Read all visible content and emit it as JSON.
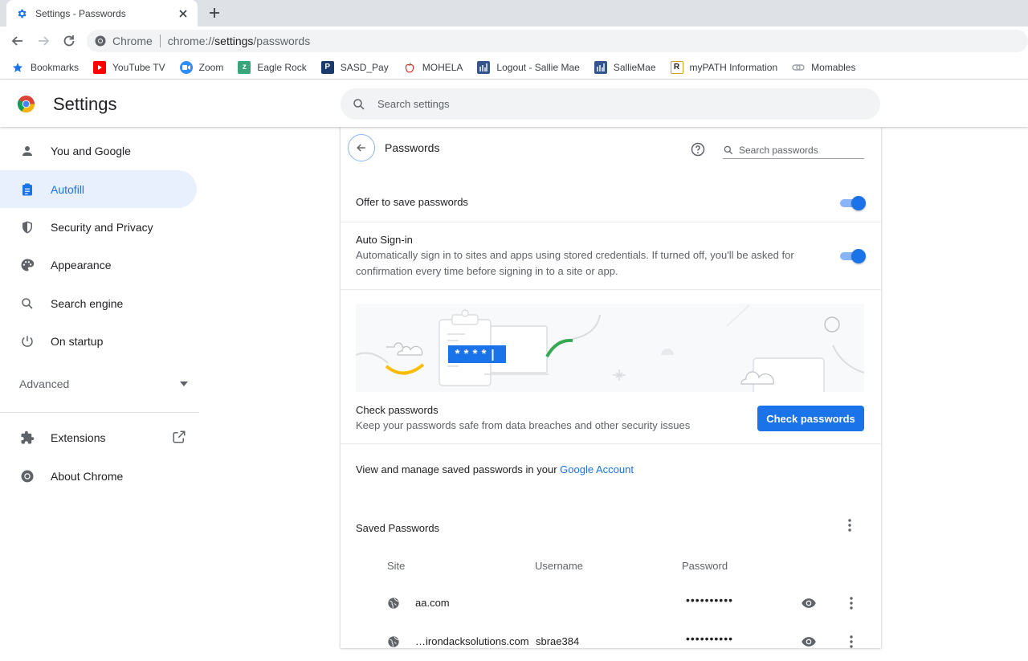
{
  "tab": {
    "title": "Settings - Passwords"
  },
  "omnibox": {
    "host": "Chrome",
    "url_prefix": "chrome://",
    "url_bold": "settings",
    "url_suffix": "/passwords"
  },
  "bookmarks": [
    {
      "label": "Bookmarks",
      "icon": "star-icon",
      "color": "#1a73e8"
    },
    {
      "label": "YouTube TV",
      "icon": "youtube-icon",
      "color": "#ff0000"
    },
    {
      "label": "Zoom",
      "icon": "zoom-icon",
      "color": "#2d8cff"
    },
    {
      "label": "Eagle Rock",
      "icon": "z-icon",
      "color": "#3aa57a"
    },
    {
      "label": "SASD_Pay",
      "icon": "p-icon",
      "color": "#1b3b6f"
    },
    {
      "label": "MOHELA",
      "icon": "apple-icon",
      "color": "#d93025"
    },
    {
      "label": "Logout - Sallie Mae",
      "icon": "salliemae-icon",
      "color": "#34558b"
    },
    {
      "label": "SallieMae",
      "icon": "salliemae-icon",
      "color": "#34558b"
    },
    {
      "label": "myPATH Information",
      "icon": "r-icon",
      "color": "#c9a227"
    },
    {
      "label": "Momables",
      "icon": "link-icon",
      "color": "#9aa0a6"
    }
  ],
  "header": {
    "title": "Settings",
    "search_placeholder": "Search settings"
  },
  "sidebar": {
    "items": [
      {
        "label": "You and Google",
        "icon": "person-icon"
      },
      {
        "label": "Autofill",
        "icon": "clipboard-icon"
      },
      {
        "label": "Security and Privacy",
        "icon": "shield-icon"
      },
      {
        "label": "Appearance",
        "icon": "palette-icon"
      },
      {
        "label": "Search engine",
        "icon": "search-icon"
      },
      {
        "label": "On startup",
        "icon": "power-icon"
      }
    ],
    "advanced": "Advanced",
    "extensions": "Extensions",
    "about": "About Chrome"
  },
  "passwords": {
    "title": "Passwords",
    "search_placeholder": "Search passwords",
    "offer_save": "Offer to save passwords",
    "auto_signin": "Auto Sign-in",
    "auto_signin_desc": "Automatically sign in to sites and apps using stored credentials. If turned off, you'll be asked for confirmation every time before signing in to a site or app.",
    "banner_text": "****|",
    "check_title": "Check passwords",
    "check_desc": "Keep your passwords safe from data breaches and other security issues",
    "check_button": "Check passwords",
    "manage_prefix": "View and manage saved passwords in your ",
    "manage_link": "Google Account",
    "saved_title": "Saved Passwords",
    "columns": {
      "site": "Site",
      "username": "Username",
      "password": "Password"
    },
    "rows": [
      {
        "site": "aa.com",
        "username": "",
        "password": "••••••••••"
      },
      {
        "site": "…irondacksolutions.com",
        "username": "sbrae384",
        "password": "••••••••••"
      }
    ]
  },
  "colors": {
    "accent": "#1a73e8",
    "active_bg": "#e8f0fe"
  }
}
